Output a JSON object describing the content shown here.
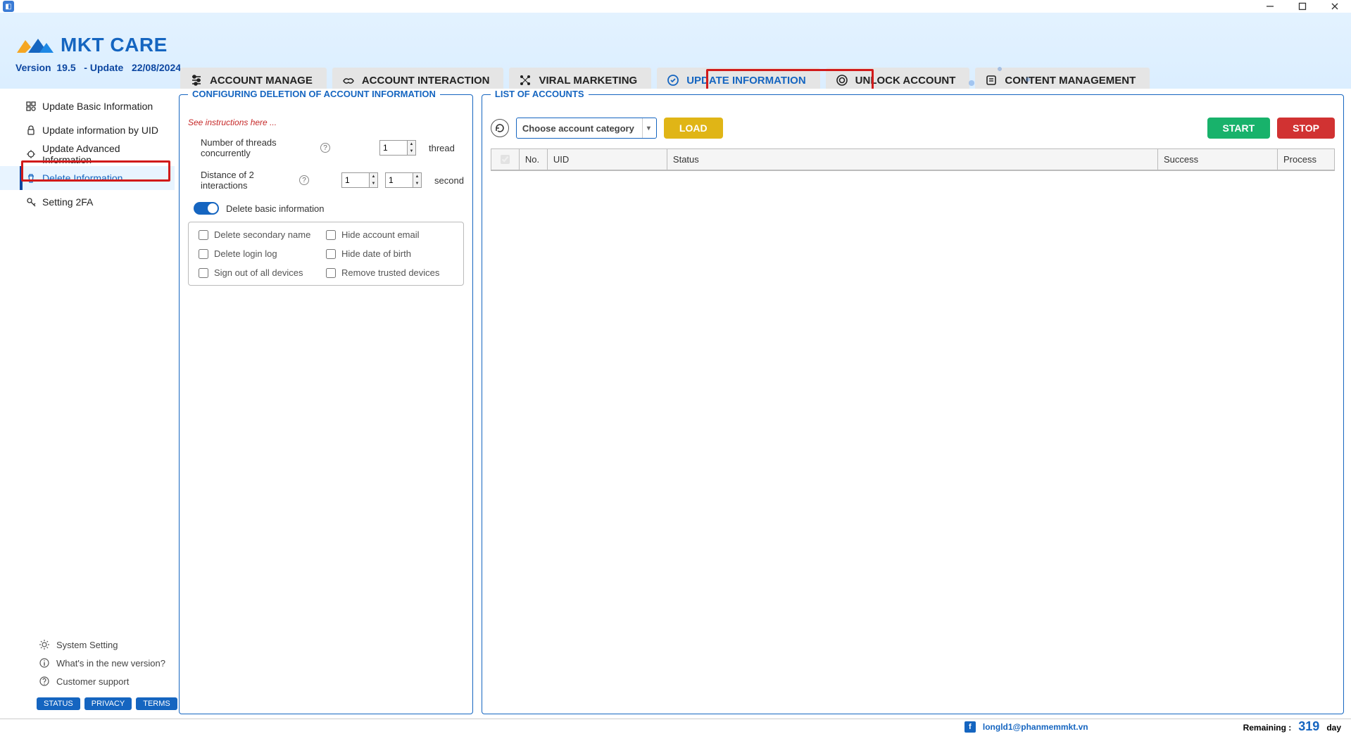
{
  "app": {
    "name": "MKT CARE"
  },
  "version": {
    "label": "Version",
    "value": "19.5",
    "update_label": "- Update",
    "update_date": "22/08/2024"
  },
  "main_tabs": [
    {
      "label": "ACCOUNT MANAGE"
    },
    {
      "label": "ACCOUNT INTERACTION"
    },
    {
      "label": "VIRAL MARKETING"
    },
    {
      "label": "UPDATE INFORMATION"
    },
    {
      "label": "UNLOCK ACCOUNT"
    },
    {
      "label": "CONTENT MANAGEMENT"
    }
  ],
  "sidebar": {
    "items": [
      {
        "label": "Update Basic Information"
      },
      {
        "label": "Update information by UID"
      },
      {
        "label": "Update Advanced Information"
      },
      {
        "label": "Delete Information"
      },
      {
        "label": "Setting 2FA"
      }
    ],
    "bottom": [
      {
        "label": "System Setting"
      },
      {
        "label": "What's in the new version?"
      },
      {
        "label": "Customer support"
      }
    ],
    "pills": [
      "STATUS",
      "PRIVACY",
      "TERMS"
    ]
  },
  "config_panel": {
    "title": "CONFIGURING DELETION OF ACCOUNT INFORMATION",
    "instructions": "See instructions here ...",
    "threads_label": "Number of threads concurrently",
    "threads_value": "1",
    "threads_unit": "thread",
    "distance_label": "Distance of 2 interactions",
    "distance_min": "1",
    "distance_max": "1",
    "distance_unit": "second",
    "toggle_label": "Delete basic information",
    "checks": [
      "Delete secondary name",
      "Hide account email",
      "Delete login log",
      "Hide date of birth",
      "Sign out of all devices",
      "Remove trusted devices"
    ]
  },
  "accounts_panel": {
    "title": "LIST OF ACCOUNTS",
    "combo_placeholder": "Choose account category",
    "load": "LOAD",
    "start": "START",
    "stop": "STOP",
    "columns": {
      "no": "No.",
      "uid": "UID",
      "status": "Status",
      "success": "Success",
      "process": "Process"
    }
  },
  "footer": {
    "email": "longld1@phanmemmkt.vn",
    "remaining_label": "Remaining :",
    "remaining_value": "319",
    "remaining_unit": "day"
  }
}
